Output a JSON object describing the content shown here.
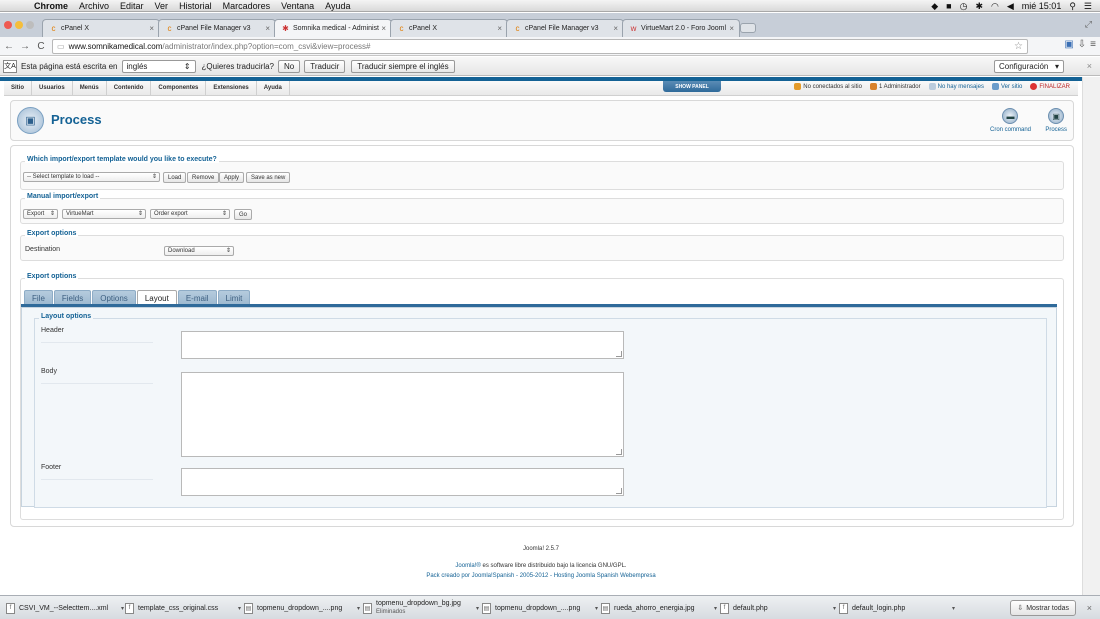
{
  "mac_menubar": {
    "items": [
      "Chrome",
      "Archivo",
      "Editar",
      "Ver",
      "Historial",
      "Marcadores",
      "Ventana",
      "Ayuda"
    ],
    "clock": "mié 15:01"
  },
  "browser": {
    "tabs": [
      {
        "label": "cPanel X",
        "favicon": "cpanel-icon"
      },
      {
        "label": "cPanel File Manager v3",
        "favicon": "cpanel-icon"
      },
      {
        "label": "Somnika medical - Administ",
        "favicon": "joomla-icon",
        "active": true
      },
      {
        "label": "cPanel X",
        "favicon": "cpanel-icon"
      },
      {
        "label": "cPanel File Manager v3",
        "favicon": "cpanel-icon"
      },
      {
        "label": "VirtueMart 2.0 - Foro Jooml",
        "favicon": "virtuemart-icon"
      }
    ],
    "url_host": "www.somnikamedical.com",
    "url_path": "/administrator/index.php?option=com_csvi&view=process#"
  },
  "translate_bar": {
    "message": "Esta página está escrita en",
    "language": "inglés",
    "question": "¿Quieres traducirla?",
    "no_button": "No",
    "translate_button": "Traducir",
    "always_button": "Traducir siempre el inglés",
    "config_button": "Configuración"
  },
  "joomla": {
    "menu": [
      "Sitio",
      "Usuarios",
      "Menús",
      "Contenido",
      "Componentes",
      "Extensiones",
      "Ayuda"
    ],
    "show_panel": "SHOW PANEL",
    "status": {
      "not_connected": "No conectados al sitio",
      "admins": "1 Administrador",
      "messages": "No hay mensajes",
      "view_site": "Ver sitio",
      "logout": "FINALIZAR"
    },
    "page_title": "Process",
    "toolbar": {
      "cron": "Cron command",
      "process": "Process"
    },
    "template_section": {
      "legend": "Which import/export template would you like to execute?",
      "select_placeholder": "-- Select template to load --",
      "buttons": [
        "Load",
        "Remove",
        "Apply",
        "Save as new"
      ]
    },
    "manual_section": {
      "legend": "Manual import/export",
      "action": "Export",
      "component": "VirtueMart",
      "operation": "Order export",
      "go": "Go"
    },
    "export_options": {
      "legend": "Export options",
      "destination_label": "Destination",
      "destination_value": "Download"
    },
    "export_options2": {
      "legend": "Export options",
      "tabs": [
        "File",
        "Fields",
        "Options",
        "Layout",
        "E-mail",
        "Limit"
      ],
      "active_tab": "Layout",
      "layout": {
        "legend": "Layout options",
        "header_label": "Header",
        "body_label": "Body",
        "footer_label": "Footer"
      }
    },
    "footer": {
      "version": "Joomla! 2.5.7",
      "license_link": "Joomla!®",
      "license_text": " es software libre distribuido bajo la licencia GNU/GPL.",
      "pack": "Pack creado por Joomla!Spanish - 2005-2012 - Hosting Joomla Spanish Webempresa"
    }
  },
  "downloads": {
    "items": [
      {
        "name": "CSVI_VM_--Selecttem....xml"
      },
      {
        "name": "template_css_original.css"
      },
      {
        "name": "topmenu_dropdown_....png"
      },
      {
        "name": "topmenu_dropdown_bg.jpg",
        "sub": "Eliminados"
      },
      {
        "name": "topmenu_dropdown_....png"
      },
      {
        "name": "rueda_ahorro_energia.jpg"
      },
      {
        "name": "default.php"
      },
      {
        "name": "default_login.php"
      }
    ],
    "show_all": "Mostrar todas"
  }
}
